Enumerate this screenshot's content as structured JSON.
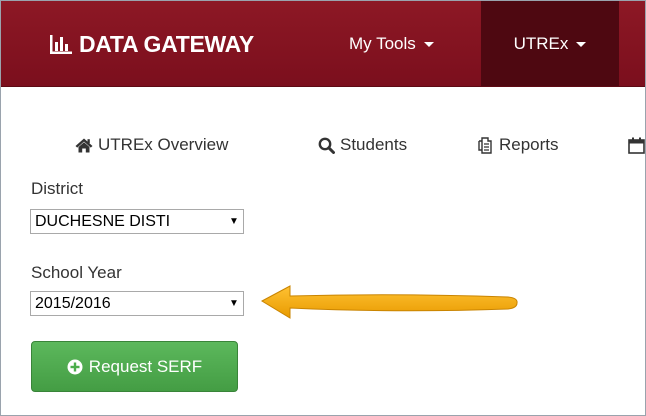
{
  "navbar": {
    "brand": "DATA GATEWAY",
    "brand_icon": "bar-chart-icon",
    "items": [
      {
        "label": "My Tools"
      },
      {
        "label": "UTREx"
      }
    ],
    "bg_color": "#7b0f1d",
    "active_bg_color": "#4e0811"
  },
  "tabs": [
    {
      "label": "UTREx Overview",
      "icon": "home-icon"
    },
    {
      "label": "Students",
      "icon": "search-icon"
    },
    {
      "label": "Reports",
      "icon": "copy-icon"
    },
    {
      "label": "",
      "icon": "calendar-icon"
    }
  ],
  "form": {
    "district": {
      "label": "District",
      "value": "DUCHESNE DISTI"
    },
    "school_year": {
      "label": "School Year",
      "value": "2015/2016"
    },
    "request_button": {
      "label": "Request SERF",
      "icon": "plus-circle-icon",
      "color": "#5cb85c"
    }
  },
  "annotation": {
    "type": "arrow",
    "color": "#f2a900",
    "points_to": "school-year-select"
  }
}
